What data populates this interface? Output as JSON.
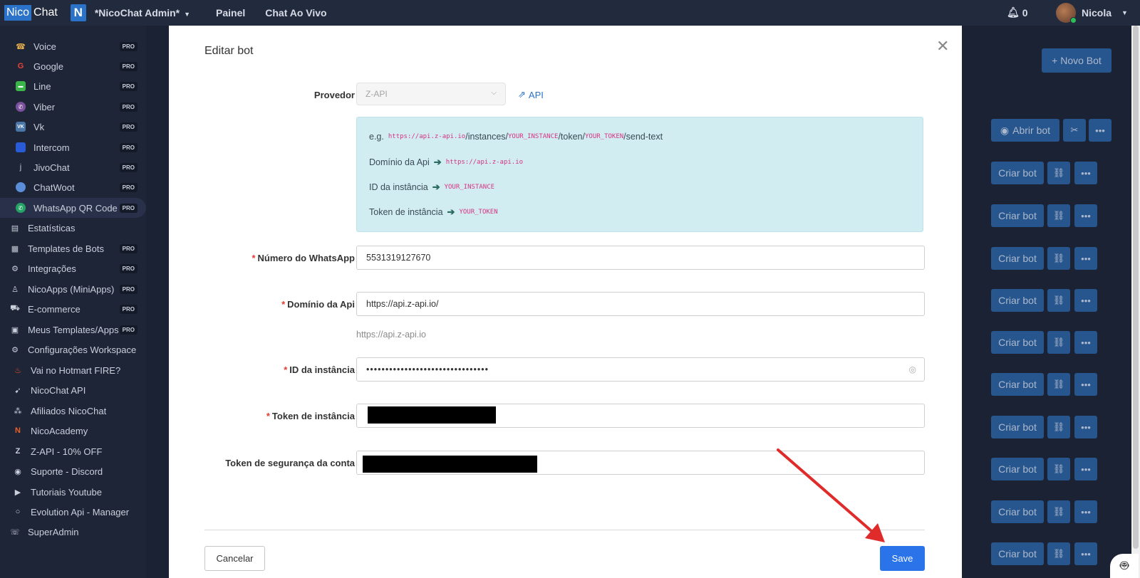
{
  "topbar": {
    "logo_part1": "Nico",
    "logo_part2": "Chat",
    "workspace_badge": "N",
    "workspace_name": "*NicoChat Admin*",
    "nav": [
      "Painel",
      "Chat Ao Vivo"
    ],
    "notifications_count": "0",
    "user_name": "Nicola"
  },
  "sidebar": {
    "items": [
      {
        "label": "Voice",
        "badge": "PRO",
        "icon": "phone-icon"
      },
      {
        "label": "Google",
        "badge": "PRO",
        "icon": "google-icon"
      },
      {
        "label": "Line",
        "badge": "PRO",
        "icon": "line-icon"
      },
      {
        "label": "Viber",
        "badge": "PRO",
        "icon": "viber-icon"
      },
      {
        "label": "Vk",
        "badge": "PRO",
        "icon": "vk-icon"
      },
      {
        "label": "Intercom",
        "badge": "PRO",
        "icon": "intercom-icon"
      },
      {
        "label": "JivoChat",
        "badge": "PRO",
        "icon": "jivochat-icon"
      },
      {
        "label": "ChatWoot",
        "badge": "PRO",
        "icon": "chatwoot-icon"
      },
      {
        "label": "WhatsApp QR Code",
        "badge": "PRO",
        "icon": "whatsapp-icon"
      },
      {
        "label": "Estatísticas",
        "badge": "",
        "icon": "chart-icon"
      },
      {
        "label": "Templates de Bots",
        "badge": "PRO",
        "icon": "document-icon"
      },
      {
        "label": "Integrações",
        "badge": "PRO",
        "icon": "integrations-icon"
      },
      {
        "label": "NicoApps (MiniApps)",
        "badge": "PRO",
        "icon": "user-icon"
      },
      {
        "label": "E-commerce",
        "badge": "PRO",
        "icon": "cart-icon"
      },
      {
        "label": "Meus Templates/Apps",
        "badge": "PRO",
        "icon": "file-icon"
      },
      {
        "label": "Configurações Workspace",
        "badge": "",
        "icon": "gear-icon"
      },
      {
        "label": "Vai no Hotmart FIRE?",
        "badge": "",
        "icon": "fire-icon"
      },
      {
        "label": "NicoChat API",
        "badge": "",
        "icon": "rocket-icon"
      },
      {
        "label": "Afiliados NicoChat",
        "badge": "",
        "icon": "network-icon"
      },
      {
        "label": "NicoAcademy",
        "badge": "",
        "icon": "n-logo-icon"
      },
      {
        "label": "Z-API - 10% OFF",
        "badge": "",
        "icon": "zapi-icon"
      },
      {
        "label": "Suporte - Discord",
        "badge": "",
        "icon": "discord-icon"
      },
      {
        "label": "Tutoriais Youtube",
        "badge": "",
        "icon": "youtube-icon"
      },
      {
        "label": "Evolution Api - Manager",
        "badge": "",
        "icon": "circle-icon"
      },
      {
        "label": "SuperAdmin",
        "badge": "",
        "icon": "handshake-icon"
      }
    ]
  },
  "background": {
    "new_bot_label": "+ Novo Bot",
    "open_bot_label": "Abrir bot",
    "create_bot_label": "Criar bot"
  },
  "modal": {
    "title": "Editar bot",
    "provider_label": "Provedor",
    "provider_value": "Z-API",
    "api_link": "API",
    "info": {
      "eg_prefix": "e.g.",
      "eg_url_1": "https://api.z-api.io",
      "eg_url_2": "/instances/",
      "eg_url_3": "YOUR_INSTANCE",
      "eg_url_4": "/token/",
      "eg_url_5": "YOUR_TOKEN",
      "eg_url_6": "/send-text",
      "domain_label": "Domínio da Api",
      "domain_value": "https://api.z-api.io",
      "instance_label": "ID da instância",
      "instance_value": "YOUR_INSTANCE",
      "token_label": "Token de instância",
      "token_value": "YOUR_TOKEN"
    },
    "fields": {
      "whatsapp_label": "Número do WhatsApp",
      "whatsapp_value": "5531319127670",
      "domain_label": "Domínio da Api",
      "domain_value": "https://api.z-api.io/",
      "domain_hint": "https://api.z-api.io",
      "instance_label": "ID da instância",
      "instance_value": "••••••••••••••••••••••••••••••••",
      "token_label": "Token de instância",
      "security_label": "Token de segurança da conta"
    },
    "cancel_label": "Cancelar",
    "save_label": "Save"
  },
  "colors": {
    "primary": "#2a73e8",
    "sidebar_bg": "#1e2537",
    "info_bg": "#d2edf1",
    "required": "#e03c31",
    "annotation_arrow": "#e02b2b"
  }
}
